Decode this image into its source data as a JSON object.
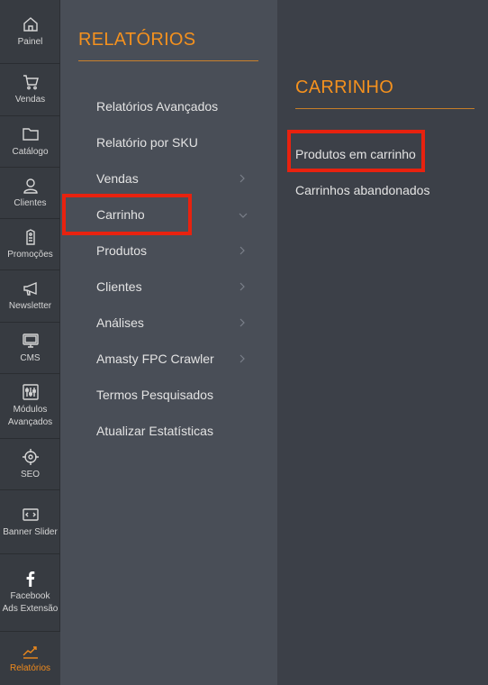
{
  "rail": {
    "items": [
      {
        "label": "Painel",
        "icon": "home-icon"
      },
      {
        "label": "Vendas",
        "icon": "cart-icon"
      },
      {
        "label": "Catálogo",
        "icon": "folder-icon"
      },
      {
        "label": "Clientes",
        "icon": "person-icon"
      },
      {
        "label": "Promoções",
        "icon": "tag-icon"
      },
      {
        "label": "Newsletter",
        "icon": "megaphone-icon"
      },
      {
        "label": "CMS",
        "icon": "monitor-icon"
      },
      {
        "label": "Módulos Avançados",
        "icon": "sliders-icon"
      },
      {
        "label": "SEO",
        "icon": "crosshair-icon"
      },
      {
        "label": "Banner Slider",
        "icon": "banner-icon"
      },
      {
        "label": "Facebook Ads Extensão",
        "icon": "facebook-icon"
      },
      {
        "label": "Relatórios",
        "icon": "chart-icon",
        "active": true
      }
    ]
  },
  "reports_panel": {
    "title": "RELATÓRIOS",
    "items": [
      {
        "label": "Relatórios Avançados",
        "has_submenu": false
      },
      {
        "label": "Relatório por SKU",
        "has_submenu": false
      },
      {
        "label": "Vendas",
        "has_submenu": true
      },
      {
        "label": "Carrinho",
        "has_submenu": true,
        "expanded": true
      },
      {
        "label": "Produtos",
        "has_submenu": true
      },
      {
        "label": "Clientes",
        "has_submenu": true
      },
      {
        "label": "Análises",
        "has_submenu": true
      },
      {
        "label": "Amasty FPC Crawler",
        "has_submenu": true
      },
      {
        "label": "Termos Pesquisados",
        "has_submenu": false
      },
      {
        "label": "Atualizar Estatísticas",
        "has_submenu": false
      }
    ]
  },
  "cart_panel": {
    "title": "CARRINHO",
    "items": [
      {
        "label": "Produtos em carrinho"
      },
      {
        "label": "Carrinhos abandonados"
      }
    ]
  },
  "colors": {
    "accent": "#f4911e",
    "highlight": "#e8220f",
    "rail_bg": "#373b41",
    "panel1_bg": "#494e57",
    "panel2_bg": "#3c4048"
  }
}
